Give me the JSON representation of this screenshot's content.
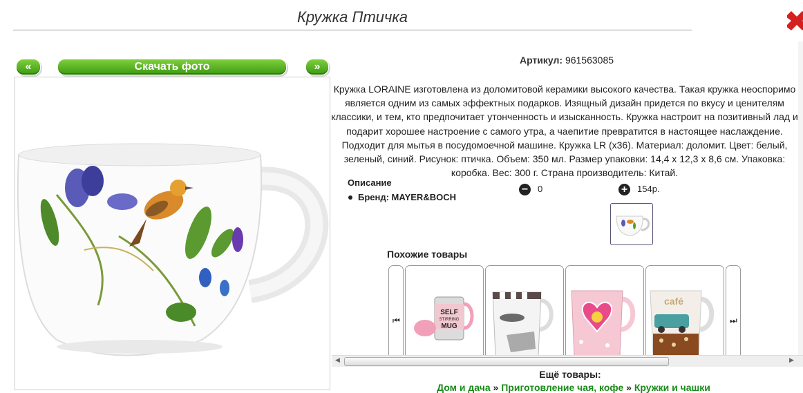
{
  "page": {
    "title": "Кружка Птичка"
  },
  "nav": {
    "prev_label": "«",
    "download_label": "Скачать фото",
    "next_label": "»"
  },
  "product": {
    "artikul_label": "Артикул:",
    "artikul_value": "961563085",
    "description": "Кружка LORAINE изготовлена из доломитовой керамики высокого качества. Такая кружка неоспоримо является одним из самых эффектных подарков. Изящный дизайн придется по вкусу и ценителям классики, и тем, кто предпочитает утонченность и изысканность. Кружка настроит на позитивный лад и подарит хорошее настроение с самого утра, а чаепитие превратится в настоящее наслаждение. Подходит для мытья в посудомоечной машине. Кружка LR (х36). Материал: доломит. Цвет: белый, зеленый, синий. Рисунок: птичка. Объем: 350 мл. Размер упаковки: 14,4 х 12,3 х 8,6 см. Упаковка: коробка. Вес: 300 г. Страна производитель: Китай.",
    "opisanie_label": "Описание",
    "brand_label": "Бренд: MAYER&BOCH",
    "quantity": "0",
    "price": "154р."
  },
  "similar": {
    "heading": "Похожие товары",
    "items": [
      {
        "name": "self-stirring-mug",
        "text": "SELF STIRRING MUG"
      },
      {
        "name": "black-white-mug",
        "text": ""
      },
      {
        "name": "pink-heart-mug",
        "text": ""
      },
      {
        "name": "retro-car-mug",
        "text": ""
      }
    ]
  },
  "footer": {
    "more_label": "Ещё товары:",
    "crumb1": "Дом и дача",
    "crumb2": "Приготовление чая, кофе",
    "crumb3": "Кружки и чашки",
    "sep": " » "
  },
  "colors": {
    "green_button": "#4caf1c",
    "link_green": "#1a8a1a",
    "close_red": "#d62020"
  },
  "icons": {
    "minus": "minus-circle-icon",
    "plus": "plus-circle-icon",
    "close": "close-icon",
    "carousel_prev": "skip-prev-icon",
    "carousel_next": "skip-next-icon"
  }
}
